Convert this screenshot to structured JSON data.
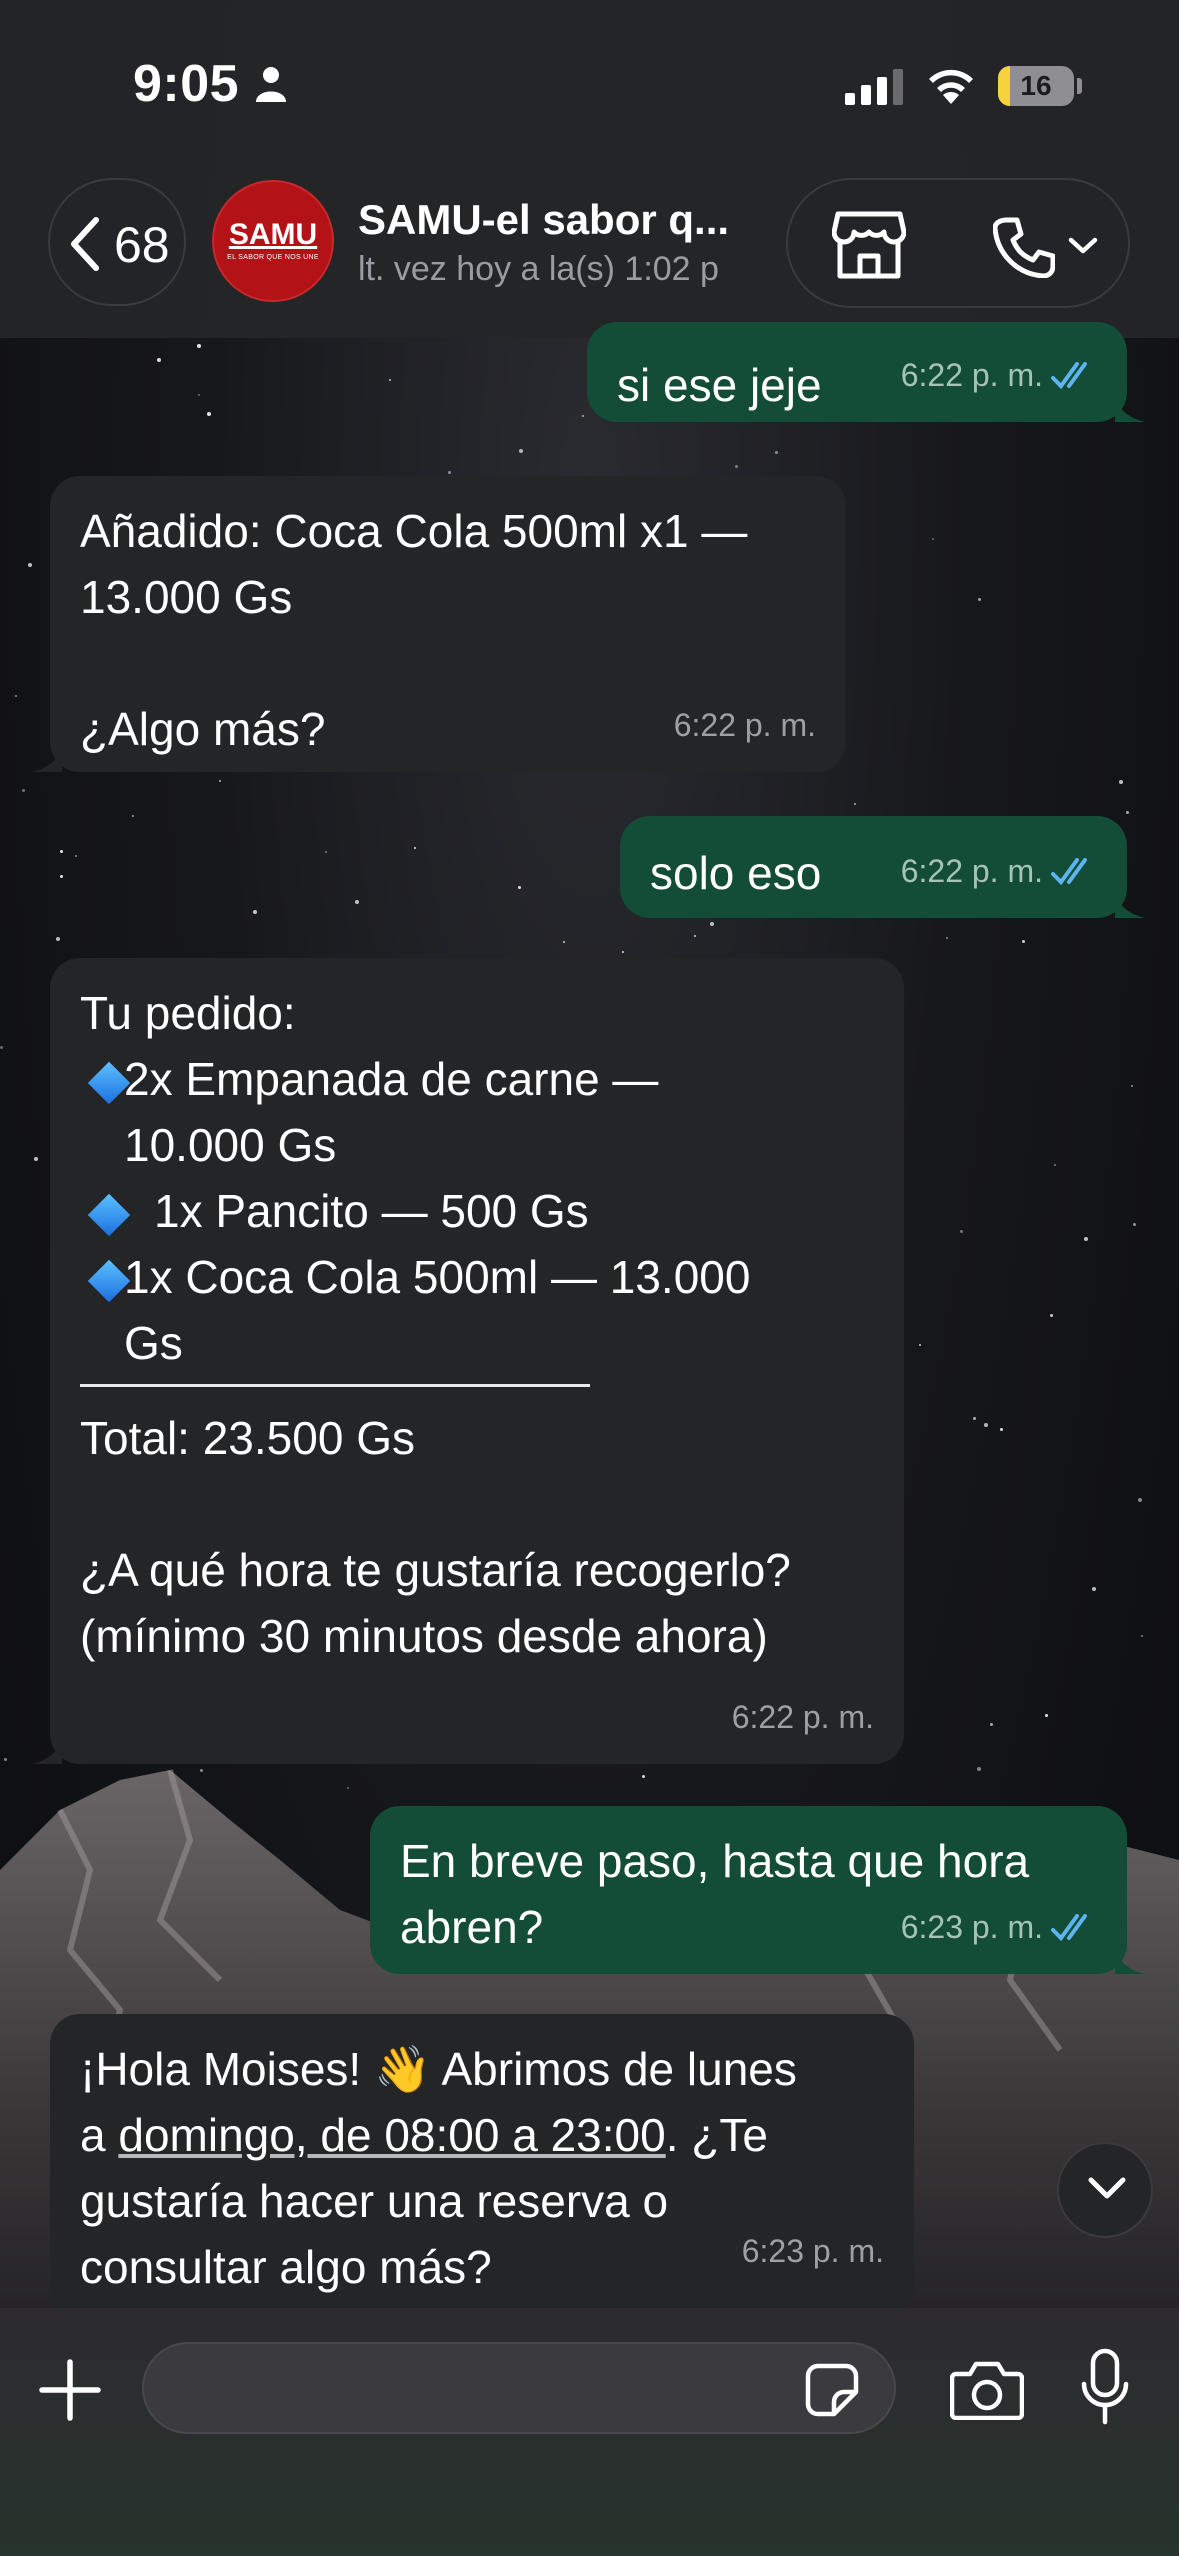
{
  "status_bar": {
    "time": "9:05",
    "battery_level": "16",
    "battery_fraction": 0.16,
    "person-icon": "person-icon",
    "signal-icon": "signal-icon",
    "wifi-icon": "wifi-icon"
  },
  "header": {
    "back_count": "68",
    "contact_name": "SAMU-el sabor q...",
    "contact_status": "lt. vez hoy a la(s) 1:02 p",
    "avatar_logo": "SAMU",
    "avatar_sub": "EL SABOR QUE NOS UNE",
    "icons": [
      "chevron-left-icon",
      "store-icon",
      "phone-icon",
      "chevron-down-icon"
    ]
  },
  "messages": [
    {
      "direction": "out",
      "text": "si ese jeje",
      "time": "6:22 p. m.",
      "read": true
    },
    {
      "direction": "in",
      "text": "Añadido: Coca Cola 500ml x1 —\n13.000 Gs\n\n¿Algo más?",
      "time": "6:22 p. m."
    },
    {
      "direction": "out",
      "text": "solo eso",
      "time": "6:22 p. m.",
      "read": true
    },
    {
      "direction": "in",
      "title": "Tu pedido:",
      "items": [
        "2x Empanada de carne —\n10.000 Gs",
        "1x Pancito — 500 Gs",
        "1x Coca Cola 500ml — 13.000\nGs"
      ],
      "total": "Total: 23.500 Gs",
      "question": "¿A qué hora te gustaría recogerlo?\n(mínimo 30 minutos desde ahora)",
      "time": "6:22 p. m."
    },
    {
      "direction": "out",
      "text": "En breve paso, hasta que hora\nabren?",
      "time": "6:23 p. m.",
      "read": true
    },
    {
      "direction": "in",
      "text_before": "¡Hola Moises! 👋 Abrimos de lunes\na ",
      "text_link": "domingo, de 08:00 a 23:00",
      "text_after": ". ¿Te\ngustaría hacer una reserva o\nconsultar algo más?",
      "time": "6:23 p. m."
    }
  ],
  "input": {
    "placeholder": "",
    "icons": [
      "plus-icon",
      "sticker-icon",
      "camera-icon",
      "microphone-icon"
    ]
  },
  "colors": {
    "outgoing_bubble": "#134d37",
    "incoming_bubble": "#242527",
    "read_ticks": "#5db4f0"
  }
}
